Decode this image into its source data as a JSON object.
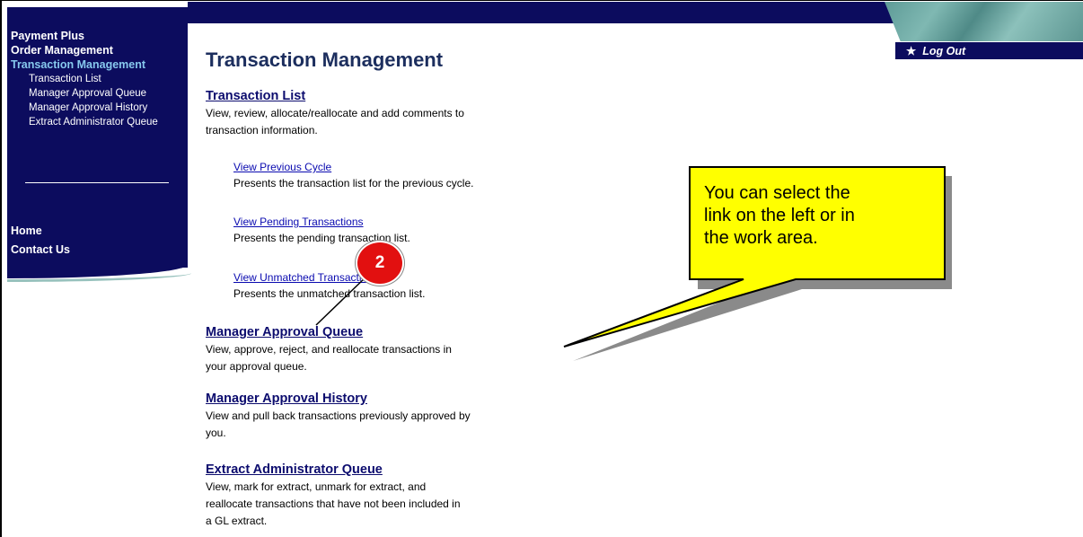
{
  "sidebar": {
    "sections": [
      "Payment Plus",
      "Order Management"
    ],
    "active_section": "Transaction Management",
    "sub_items": [
      "Transaction List",
      "Manager Approval Queue",
      "Manager Approval History",
      "Extract Administrator Queue"
    ],
    "bottom_items": [
      "Home",
      "Contact Us"
    ]
  },
  "header": {
    "logout_label": "Log Out",
    "logout_icon": "star-icon"
  },
  "main": {
    "title": "Transaction Management",
    "transaction_list": {
      "label": "Transaction List",
      "description_lines": [
        "View, review, allocate/reallocate and add comments to",
        "transaction information."
      ]
    },
    "sub_links": [
      {
        "label": "View Previous Cycle",
        "description": "Presents the transaction list for the previous cycle."
      },
      {
        "label": "View Pending Transactions",
        "description": "Presents the pending transaction list."
      },
      {
        "label": "View Unmatched Transactions",
        "description": "Presents the unmatched transaction list."
      }
    ],
    "manager_approval_queue": {
      "label": "Manager Approval Queue",
      "description_lines": [
        "View, approve, reject, and reallocate transactions in",
        "your approval queue."
      ]
    },
    "manager_approval_history": {
      "label": "Manager Approval History",
      "description_lines": [
        "View and pull back transactions previously approved by",
        "you."
      ]
    },
    "extract_admin_queue": {
      "label": "Extract Administrator Queue",
      "description_lines": [
        "View, mark for extract, unmark for extract, and",
        "reallocate transactions that have not been included in",
        "a GL extract."
      ]
    }
  },
  "callout": {
    "text_lines": [
      "You can select the",
      "link on the left or in",
      "the work area."
    ],
    "step_number": "2",
    "colors": {
      "fill": "#ffff00",
      "border": "#000000",
      "shadow": "#8a8a8a",
      "badge": "#e21010"
    }
  }
}
